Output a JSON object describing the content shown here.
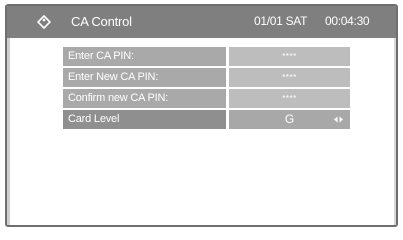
{
  "header": {
    "title": "CA Control",
    "date": "01/01 SAT",
    "time": "00:04:30",
    "icon": "tag-icon"
  },
  "menu": {
    "rows": [
      {
        "label": "Enter CA PIN:",
        "value": "****"
      },
      {
        "label": "Enter New CA PIN:",
        "value": "****"
      },
      {
        "label": "Confirm new CA PIN:",
        "value": "****"
      },
      {
        "label": "Card Level",
        "value": "G",
        "control_icon": "left-right-arrows-icon",
        "selected": true
      }
    ]
  },
  "colors": {
    "title_bar": "#7f7f7f",
    "row_label_bg": "#a9a9a9",
    "row_value_bg": "#bdbdbd",
    "text": "#ffffff"
  }
}
